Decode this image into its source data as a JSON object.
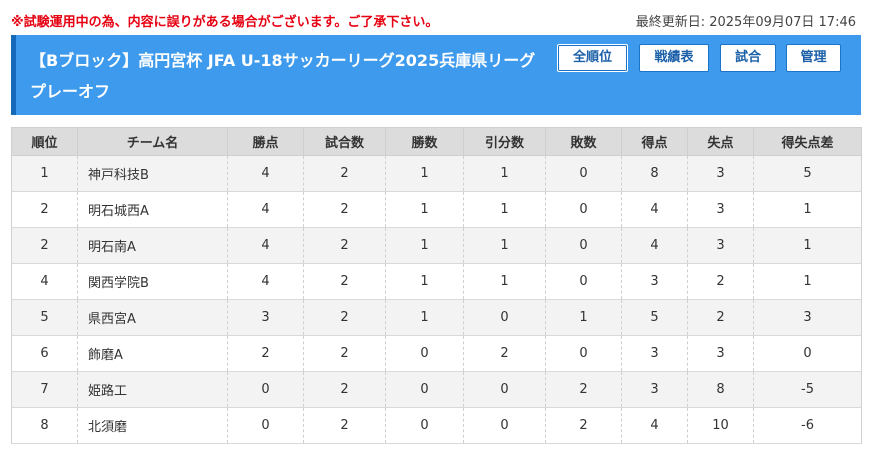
{
  "notice": "※試験運用中の為、内容に誤りがある場合がございます。ご了承下さい。",
  "updated": "最終更新日: 2025年09月07日 17:46",
  "header": {
    "title": "【Bブロック】高円宮杯 JFA U-18サッカーリーグ2025兵庫県リーグ プレーオフ",
    "buttons": [
      "全順位",
      "戦績表",
      "試合",
      "管理"
    ]
  },
  "colors": {
    "notice": "#e60012",
    "header_bg": "#3d9aec",
    "header_accent": "#1668b8",
    "button_text": "#1a5fa8"
  },
  "table": {
    "columns": [
      "順位",
      "チーム名",
      "勝点",
      "試合数",
      "勝数",
      "引分数",
      "敗数",
      "得点",
      "失点",
      "得失点差"
    ],
    "rows": [
      [
        "1",
        "神戸科技B",
        "4",
        "2",
        "1",
        "1",
        "0",
        "8",
        "3",
        "5"
      ],
      [
        "2",
        "明石城西A",
        "4",
        "2",
        "1",
        "1",
        "0",
        "4",
        "3",
        "1"
      ],
      [
        "2",
        "明石南A",
        "4",
        "2",
        "1",
        "1",
        "0",
        "4",
        "3",
        "1"
      ],
      [
        "4",
        "関西学院B",
        "4",
        "2",
        "1",
        "1",
        "0",
        "3",
        "2",
        "1"
      ],
      [
        "5",
        "県西宮A",
        "3",
        "2",
        "1",
        "0",
        "1",
        "5",
        "2",
        "3"
      ],
      [
        "6",
        "飾磨A",
        "2",
        "2",
        "0",
        "2",
        "0",
        "3",
        "3",
        "0"
      ],
      [
        "7",
        "姫路工",
        "0",
        "2",
        "0",
        "0",
        "2",
        "3",
        "8",
        "-5"
      ],
      [
        "8",
        "北須磨",
        "0",
        "2",
        "0",
        "0",
        "2",
        "4",
        "10",
        "-6"
      ]
    ]
  }
}
